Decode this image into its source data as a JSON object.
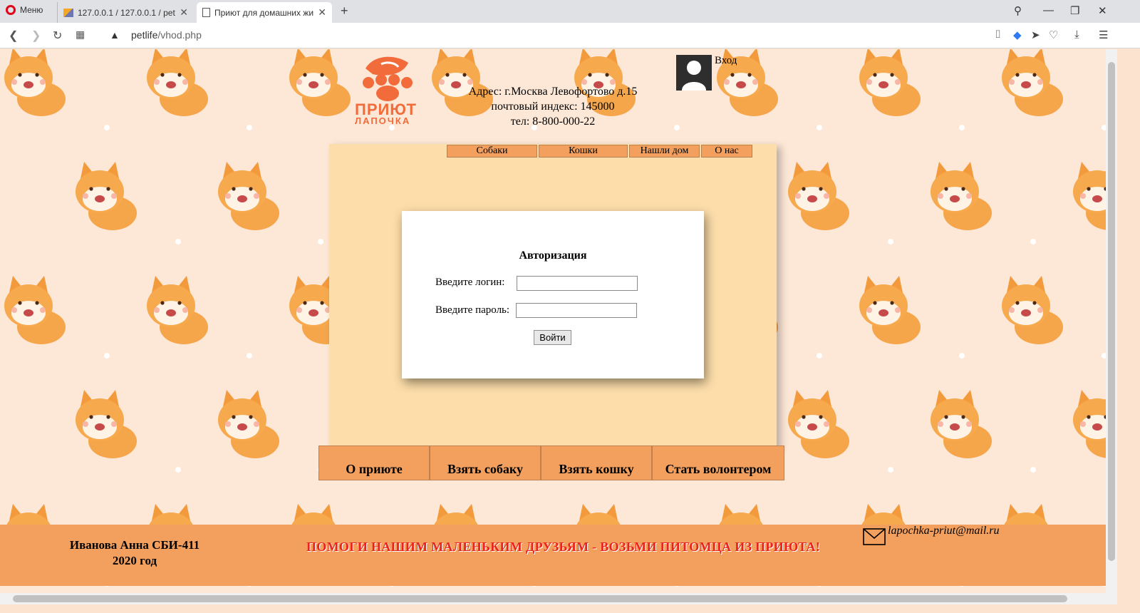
{
  "browser": {
    "menu_label": "Меню",
    "tabs": [
      {
        "title": "127.0.0.1 / 127.0.0.1 / pet /",
        "active": false
      },
      {
        "title": "Приют для домашних жи",
        "active": true
      }
    ],
    "url_host": "petlife",
    "url_path": "/vhod.php"
  },
  "header": {
    "logo_text": "ПРИЮТ",
    "logo_subtext": "ЛАПОЧКА",
    "address": "Адрес: г.Москва Левофортово д.15",
    "postcode": "почтовый индекс: 145000",
    "phone": "тел: 8-800-000-22",
    "login_link": "Вход"
  },
  "top_nav": [
    "Собаки",
    "Кошки",
    "Нашли дом",
    "О нас"
  ],
  "login_form": {
    "title": "Авторизация",
    "login_label": "Введите логин:",
    "login_value": "",
    "password_label": "Введите пароль:",
    "password_value": "",
    "submit_label": "Войти"
  },
  "bottom_nav": [
    "О приюте",
    "Взять собаку",
    "Взять кошку",
    "Стать волонтером"
  ],
  "footer": {
    "author": "Иванова Анна СБИ-411",
    "year": "2020 год",
    "slogan": "ПОМОГИ НАШИМ МАЛЕНЬКИМ ДРУЗЬЯМ - ВОЗЬМИ ПИТОМЦА ИЗ ПРИЮТА!",
    "email": "lapochka-priut@mail.ru"
  },
  "colors": {
    "accent": "#f3a05f",
    "panel": "#fddeaa",
    "background": "#fde7d6",
    "slogan": "#e8241d"
  }
}
